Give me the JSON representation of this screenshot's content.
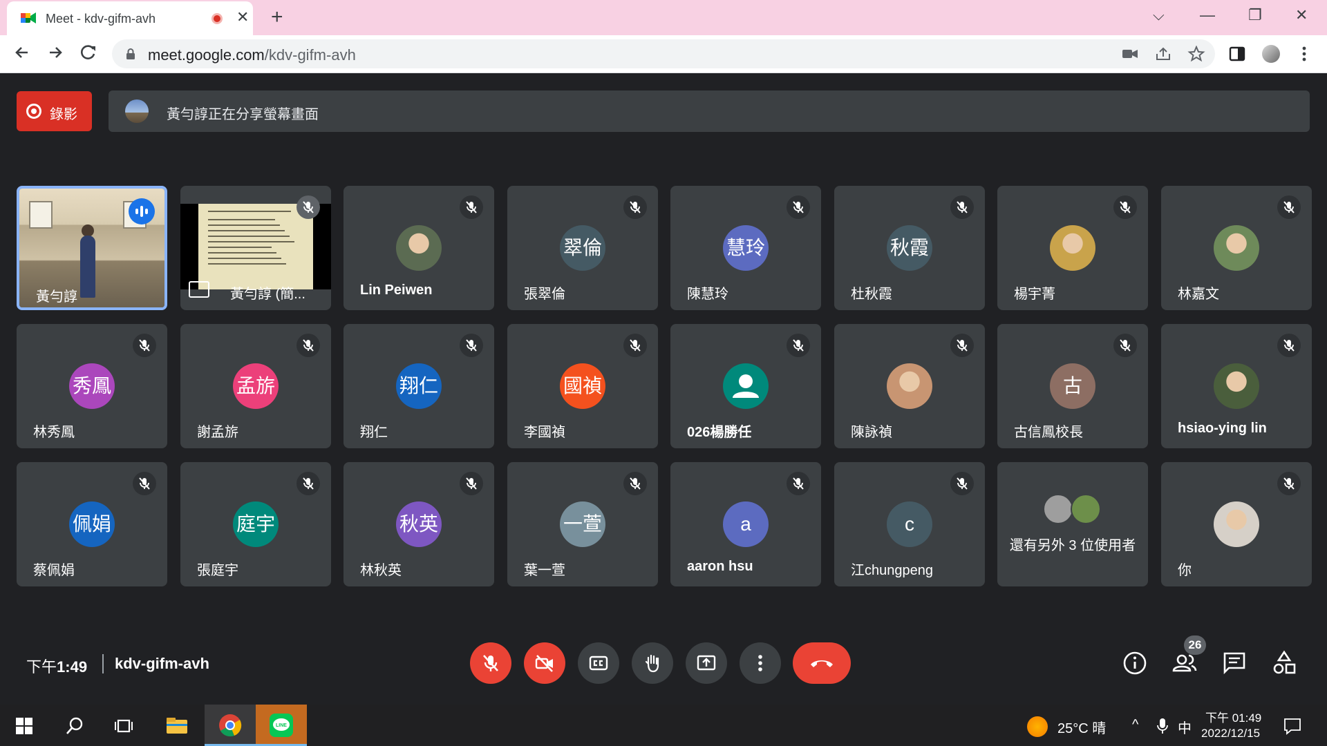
{
  "browser": {
    "tab_title": "Meet - kdv-gifm-avh",
    "new_tab_glyph": "+",
    "close_glyph": "✕",
    "minimize_glyph": "—",
    "maximize_glyph": "❐",
    "window_close_glyph": "✕",
    "tablist_glyph": "⌵",
    "url_host": "meet.google.com",
    "url_path": "/kdv-gifm-avh"
  },
  "meet": {
    "record_label": "錄影",
    "share_banner": "黃勻諄正在分享螢幕畫面",
    "tiles": [
      {
        "name": "黃勻諄",
        "type": "camera",
        "speaking": true
      },
      {
        "name": "黃勻諄 (簡...",
        "type": "presentation"
      },
      {
        "name": "Lin Peiwen",
        "type": "photo",
        "bold": true,
        "color": "#5b6b52"
      },
      {
        "name": "張翠倫",
        "initials": "翠倫",
        "color": "#455a64"
      },
      {
        "name": "陳慧玲",
        "initials": "慧玲",
        "color": "#5c6bc0"
      },
      {
        "name": "杜秋霞",
        "initials": "秋霞",
        "color": "#455a64"
      },
      {
        "name": "楊宇菁",
        "type": "photo",
        "color": "#c9a34b"
      },
      {
        "name": "林嘉文",
        "type": "photo",
        "color": "#6e8a5a"
      },
      {
        "name": "林秀鳳",
        "initials": "秀鳳",
        "color": "#ab47bc"
      },
      {
        "name": "謝孟旂",
        "initials": "孟旂",
        "color": "#ec407a"
      },
      {
        "name": "翔仁",
        "initials": "翔仁",
        "color": "#1565c0"
      },
      {
        "name": "李國禎",
        "initials": "國禎",
        "color": "#f4511e"
      },
      {
        "name": "026楊勝任",
        "type": "default-avatar",
        "bold": true,
        "color": "#00897b"
      },
      {
        "name": "陳詠禎",
        "type": "photo",
        "color": "#c89572"
      },
      {
        "name": "古信鳳校長",
        "initials": "古",
        "color": "#8d6e63"
      },
      {
        "name": "hsiao-ying lin",
        "type": "photo",
        "bold": true,
        "color": "#4a5e3c"
      },
      {
        "name": "蔡佩娟",
        "initials": "佩娟",
        "color": "#1565c0"
      },
      {
        "name": "張庭宇",
        "initials": "庭宇",
        "color": "#00897b"
      },
      {
        "name": "林秋英",
        "initials": "秋英",
        "color": "#7e57c2"
      },
      {
        "name": "葉一萱",
        "initials": "一萱",
        "color": "#78909c"
      },
      {
        "name": "aaron hsu",
        "initials": "a",
        "bold": true,
        "color": "#5c6bc0"
      },
      {
        "name": "江chungpeng",
        "initials": "c",
        "color": "#455a64"
      },
      {
        "name": "還有另外 3 位使用者",
        "type": "more"
      },
      {
        "name": "你",
        "type": "photo",
        "color": "#d6d0c8"
      }
    ],
    "time": "下午1:49",
    "time_prefix": "下午",
    "time_value": "1:49",
    "meeting_code": "kdv-gifm-avh",
    "participant_count": "26"
  },
  "taskbar": {
    "weather": "25°C 晴",
    "ime": "中",
    "tray_time": "下午 01:49",
    "tray_date": "2022/12/15",
    "chevron": "^"
  },
  "colors": {
    "record_red": "#d93025",
    "control_red": "#ea4335",
    "tile_bg": "#3c4043",
    "speaking_blue": "#1a73e8",
    "active_border": "#8ab4f8",
    "tab_strip": "#f8d1e3"
  }
}
